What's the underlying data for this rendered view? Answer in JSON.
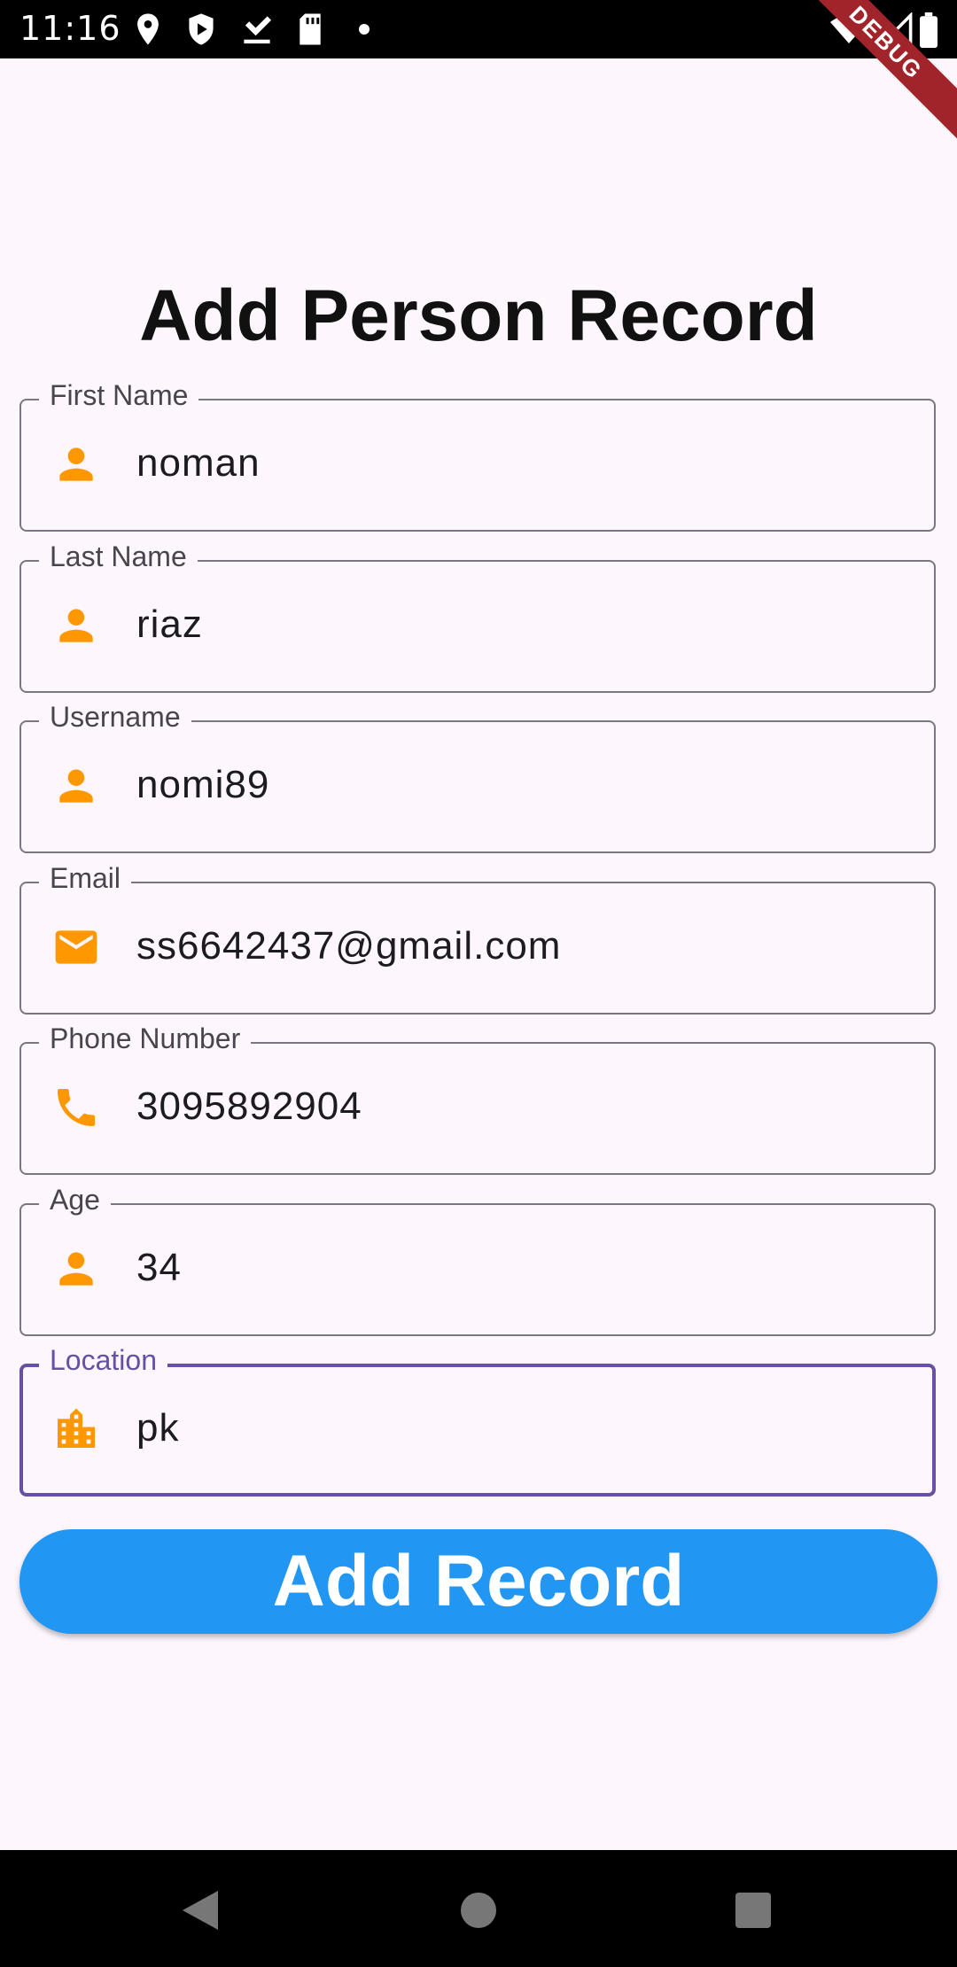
{
  "status_bar": {
    "time": "11:16"
  },
  "debug_banner": "DEBUG",
  "page": {
    "title": "Add Person Record"
  },
  "colors": {
    "icon": "#ff9800",
    "button": "#2196f3",
    "focus": "#6750a4"
  },
  "fields": [
    {
      "label": "First Name",
      "value": "noman",
      "icon": "person-icon"
    },
    {
      "label": "Last Name",
      "value": "riaz",
      "icon": "person-icon"
    },
    {
      "label": "Username",
      "value": "nomi89",
      "icon": "person-icon"
    },
    {
      "label": "Email",
      "value": "ss6642437@gmail.com",
      "icon": "email-icon"
    },
    {
      "label": "Phone Number",
      "value": "3095892904",
      "icon": "phone-icon"
    },
    {
      "label": "Age",
      "value": "34",
      "icon": "person-icon"
    },
    {
      "label": "Location",
      "value": "pk",
      "icon": "location-city-icon",
      "focused": true
    }
  ],
  "button": {
    "label": "Add Record"
  }
}
